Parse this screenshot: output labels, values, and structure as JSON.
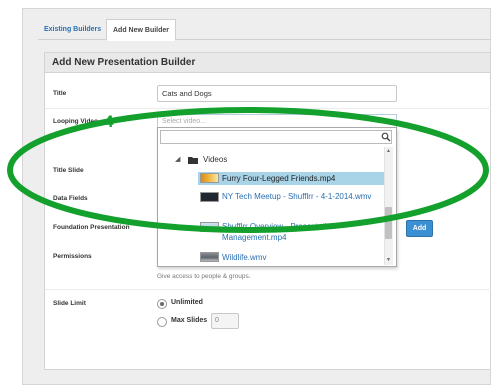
{
  "tabs": {
    "existing": "Existing Builders",
    "new": "Add New Builder"
  },
  "panel": {
    "title": "Add New Presentation Builder"
  },
  "fields": {
    "title_label": "Title",
    "title_value": "Cats and Dogs",
    "looping_label": "Looping Video",
    "looping_placeholder": "Select video...",
    "title_slide_label": "Title Slide",
    "data_fields_label": "Data Fields",
    "foundation_label": "Foundation Presentation",
    "permissions_label": "Permissions",
    "permissions_help": "Give access to people & groups.",
    "add_button": "Add",
    "slide_limit_label": "Slide Limit",
    "unlimited_label": "Unlimited",
    "max_slides_label": "Max Slides",
    "max_slides_value": "0"
  },
  "dropdown": {
    "folder": "Videos",
    "items": [
      {
        "name": "Furry Four-Legged Friends.mp4",
        "selected": true
      },
      {
        "name": "NY Tech Meetup - Shufflrr - 4-1-2014.wmv"
      },
      {
        "name": "Shufflrr Overview - Presentation Management.mp4"
      },
      {
        "name": "Wildlife.wmv"
      }
    ]
  },
  "annotation": {
    "number": "4",
    "color": "#13a02c"
  },
  "colors": {
    "link": "#2a6fb0",
    "selected_row": "#a9d4e8",
    "button": "#3b8fd3"
  }
}
